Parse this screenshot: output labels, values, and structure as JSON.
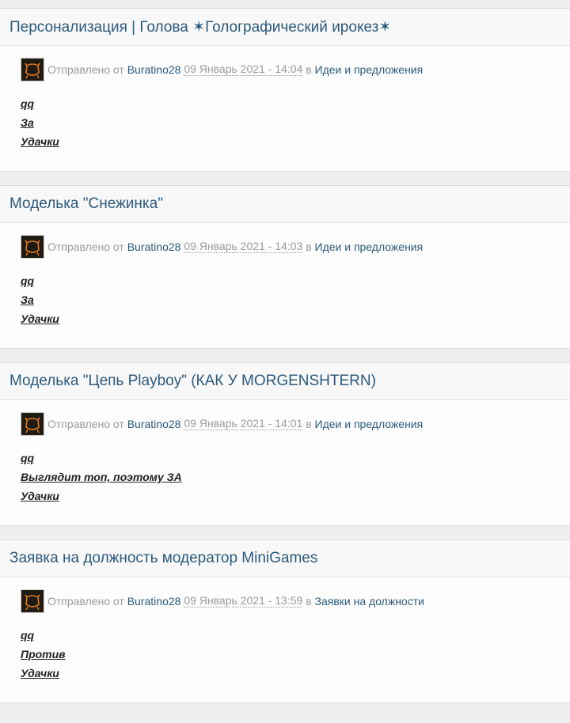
{
  "posts": [
    {
      "title": "Персонализация | Голова ✶Голографический ирокез✶",
      "meta": {
        "sent_by": "Отправлено от",
        "author": "Buratino28",
        "date": "09 Январь 2021 - 14:04",
        "in": "в",
        "forum": "Идеи и предложения"
      },
      "lines": [
        "qq",
        "За",
        "Удачки"
      ]
    },
    {
      "title": "Моделька \"Снежинка\"",
      "meta": {
        "sent_by": "Отправлено от",
        "author": "Buratino28",
        "date": "09 Январь 2021 - 14:03",
        "in": "в",
        "forum": "Идеи и предложения"
      },
      "lines": [
        "qq",
        "За",
        "Удачки"
      ]
    },
    {
      "title": "Моделька \"Цепь Playboy\" (КАК У MORGENSHTERN)",
      "meta": {
        "sent_by": "Отправлено от",
        "author": "Buratino28",
        "date": "09 Январь 2021 - 14:01",
        "in": "в",
        "forum": "Идеи и предложения"
      },
      "lines": [
        "qq",
        "Выглядит топ, поэтому ЗА",
        "Удачки"
      ]
    },
    {
      "title": "Заявка на должность модератор MiniGames",
      "meta": {
        "sent_by": "Отправлено от",
        "author": "Buratino28",
        "date": "09 Январь 2021 - 13:59",
        "in": "в",
        "forum": "Заявки на должности"
      },
      "lines": [
        "qq",
        "Против",
        "Удачки"
      ]
    }
  ]
}
